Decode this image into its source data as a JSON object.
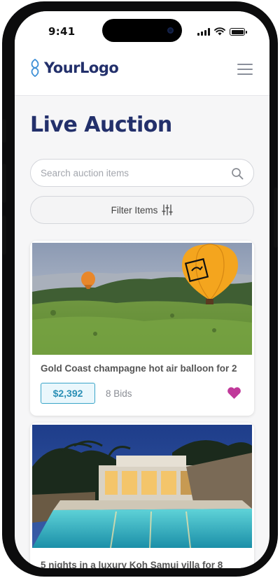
{
  "status_bar": {
    "time": "9:41"
  },
  "header": {
    "logo_text": "YourLogo",
    "menu_icon": "hamburger-menu-icon"
  },
  "page": {
    "title": "Live Auction"
  },
  "search": {
    "placeholder": "Search auction items",
    "value": ""
  },
  "filter": {
    "label": "Filter Items",
    "icon": "sliders-icon"
  },
  "auction_items": [
    {
      "title": "Gold Coast champagne hot air balloon for 2",
      "price": "$2,392",
      "bids": "8 Bids",
      "favorite": true
    },
    {
      "title": "5 nights in a luxury Koh Samui villa for 8"
    }
  ],
  "colors": {
    "brand": "#23306b",
    "accent": "#2a8fb5",
    "price_bg": "#eaf7fc",
    "heart": "#c0399a"
  }
}
